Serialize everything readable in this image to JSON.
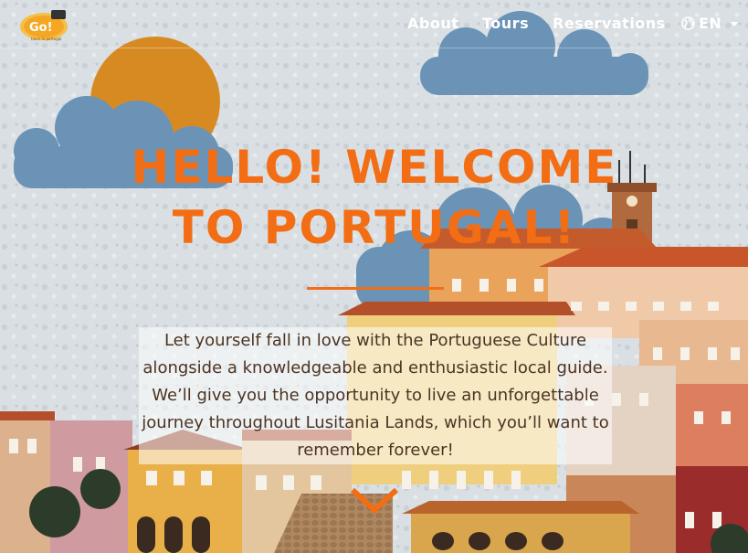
{
  "nav": {
    "about_label": "About",
    "tours_label": "Tours",
    "reservations_label": "Reservations",
    "language_label": "EN"
  },
  "logo": {
    "wordmark": "Go!",
    "tagline": "tours in portugal"
  },
  "hero": {
    "title": "HELLO! WELCOME TO PORTUGAL!",
    "intro": "Let yourself fall in love with the Portuguese Culture alongside a knowledgeable and enthusiastic local guide. We’ll give you the opportunity to live an unforgettable journey throughout Lusitania Lands, which you’ll want to remember forever!"
  },
  "icons": {
    "logo": "logo-icon",
    "language": "globe-icon",
    "dropdown": "caret-down-icon",
    "scroll": "chevron-down-icon"
  },
  "colors": {
    "accent": "#f26d14",
    "sky": "#d9dfe3",
    "cloud": "#6a93b6",
    "sun": "#d88a22"
  }
}
